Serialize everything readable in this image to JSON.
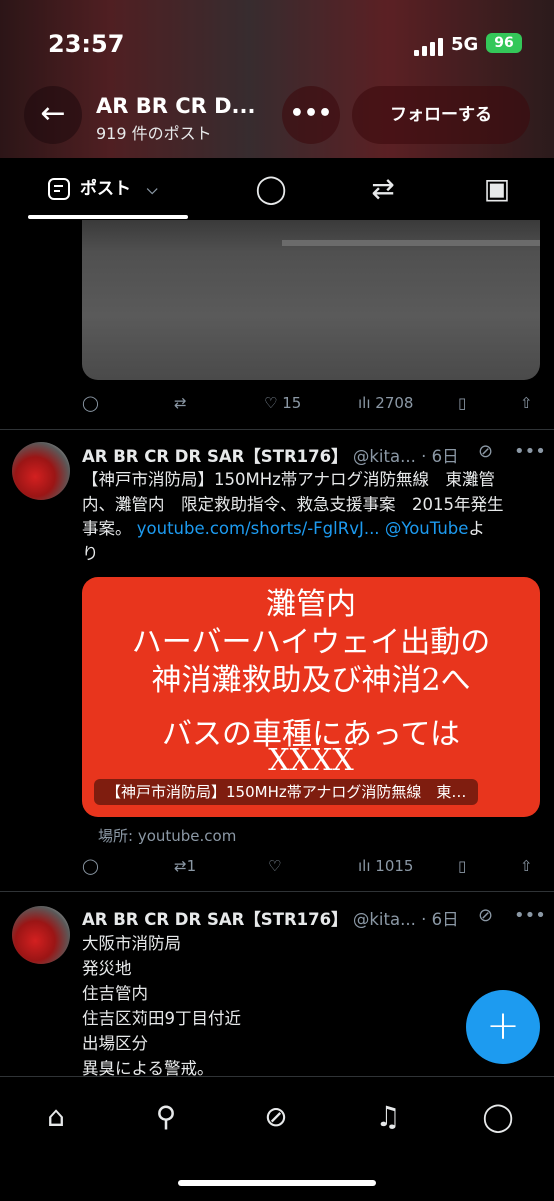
{
  "status": {
    "time": "23:57",
    "network": "5G",
    "battery": "96"
  },
  "header": {
    "back_icon": "arrow-left-icon",
    "name": "AR BR CR D...",
    "post_count": "919 件のポスト",
    "more_icon": "more-icon",
    "follow_label": "フォローする"
  },
  "tabs": {
    "posts_label": "ポスト",
    "icons": [
      "posts-icon",
      "replies-icon",
      "retweet-icon",
      "media-icon"
    ]
  },
  "post1": {
    "likes": "15",
    "views": "2708"
  },
  "post2": {
    "name": "AR BR CR DR SAR【STR176】",
    "handle": "@kita...",
    "time": "· 6日",
    "text_lines": [
      "【神戸市消防局】150MHz帯アナログ消防無線　東灘管",
      "内、灘管内　限定救助指令、救急支援事案　2015年発生"
    ],
    "text_line3_prefix": "事案。",
    "link": "youtube.com/shorts/-FglRvJ...",
    "mention": "@YouTube",
    "suffix1": "よ",
    "suffix2": "り",
    "card_lines": [
      "灘管内",
      "ハーバーハイウェイ出動の",
      "神消灘救助及び神消2へ",
      "バスの車種にあっては",
      "XXXX"
    ],
    "card_caption": "【神戸市消防局】150MHz帯アナログ消防無線　東…",
    "source": "場所: youtube.com",
    "retweets": "1",
    "views": "1015"
  },
  "post3": {
    "name": "AR BR CR DR SAR【STR176】",
    "handle": "@kita...",
    "time": "· 6日",
    "lines": [
      "大阪市消防局",
      "発災地",
      "住吉管内",
      "住吉区苅田9丁目付近",
      "出場区分",
      "異臭による警戒。"
    ]
  },
  "fab_label": "+",
  "nav": [
    "home-icon",
    "search-icon",
    "grok-icon",
    "notifications-icon",
    "messages-icon"
  ],
  "colors": {
    "accent": "#1d9bf0",
    "text": "#e7e9ea",
    "muted": "#8b98a5",
    "card": "#e8351d"
  }
}
